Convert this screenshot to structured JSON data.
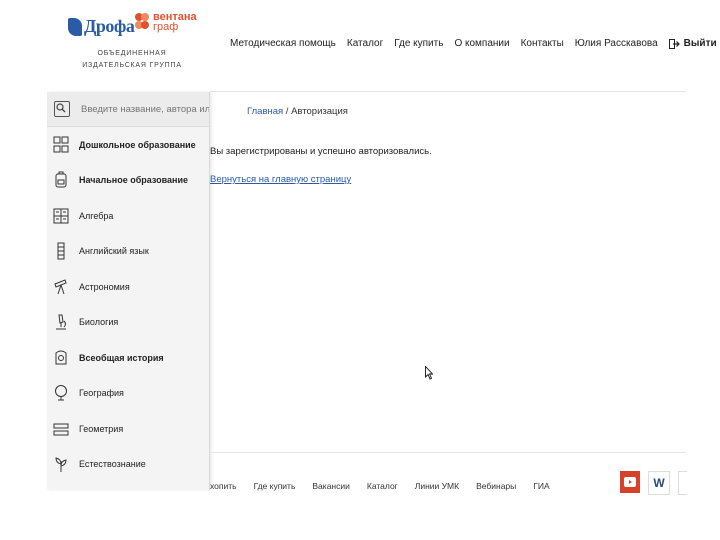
{
  "header": {
    "logo_drofa": "Дрофа",
    "logo_ventana_line1": "вентана",
    "logo_ventana_line2": "граф",
    "logo_caption": "ОБЪЕДИНЕННАЯ ИЗДАТЕЛЬСКАЯ ГРУППА",
    "nav": [
      "Методическая помощь",
      "Каталог",
      "Где купить",
      "О компании",
      "Контакты",
      "Юлия Расскавова"
    ],
    "logout_label": "Выйти"
  },
  "sidebar": {
    "search_placeholder": "Введите название, автора или ISBN",
    "items": [
      {
        "label": "Дошкольное образование",
        "icon": "blocks-icon",
        "bold": true
      },
      {
        "label": "Начальное образование",
        "icon": "backpack-icon",
        "bold": true
      },
      {
        "label": "Алгебра",
        "icon": "grid-icon"
      },
      {
        "label": "Английский язык",
        "icon": "flag-icon"
      },
      {
        "label": "Астрономия",
        "icon": "telescope-icon"
      },
      {
        "label": "Биология",
        "icon": "microscope-icon"
      },
      {
        "label": "Всеобщая история",
        "icon": "scroll-icon"
      },
      {
        "label": "География",
        "icon": "globe-icon"
      },
      {
        "label": "Геометрия",
        "icon": "ruler-icon"
      },
      {
        "label": "Естествознание",
        "icon": "plant-icon"
      }
    ]
  },
  "main": {
    "breadcrumb_home": "Главная",
    "breadcrumb_sep": " / ",
    "breadcrumb_current": "Авторизация",
    "success_message": "Вы зарегистрированы и успешно авторизовались.",
    "back_link": "Вернуться на главную страницу"
  },
  "footer": {
    "links": [
      "хопить",
      "Где купить",
      "Вакансии",
      "Каталог",
      "Линии УМК",
      "Вебинары",
      "ГИА"
    ],
    "vk_label": "W"
  },
  "colors": {
    "brand_blue": "#2b5aa6",
    "brand_orange": "#e0522d",
    "youtube_red": "#d7402b"
  }
}
